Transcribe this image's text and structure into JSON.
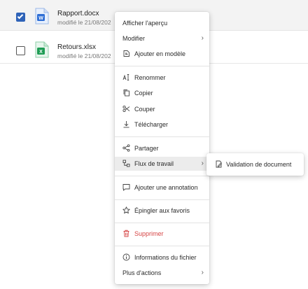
{
  "files": [
    {
      "name": "Rapport.docx",
      "meta": "modifié le 21/08/202",
      "selected": true,
      "icon": "word-doc-icon",
      "color": "#2f6fd6"
    },
    {
      "name": "Retours.xlsx",
      "meta": "modifié le 21/08/202",
      "selected": false,
      "icon": "excel-sheet-icon",
      "color": "#1f9d55"
    }
  ],
  "menu": {
    "preview": "Afficher l'aperçu",
    "edit": "Modifier",
    "add_template": "Ajouter en modèle",
    "rename": "Renommer",
    "copy": "Copier",
    "cut": "Couper",
    "download": "Télécharger",
    "share": "Partager",
    "workflow": "Flux de travail",
    "add_annotation": "Ajouter une annotation",
    "pin_favorites": "Épingler aux favoris",
    "delete": "Supprimer",
    "file_info": "Informations du fichier",
    "more_actions": "Plus d'actions",
    "chevron": "›"
  },
  "submenu": {
    "document_validation": "Validation de document"
  },
  "colors": {
    "accent": "#2f63b8",
    "danger": "#d64545",
    "hover": "#ececec"
  }
}
